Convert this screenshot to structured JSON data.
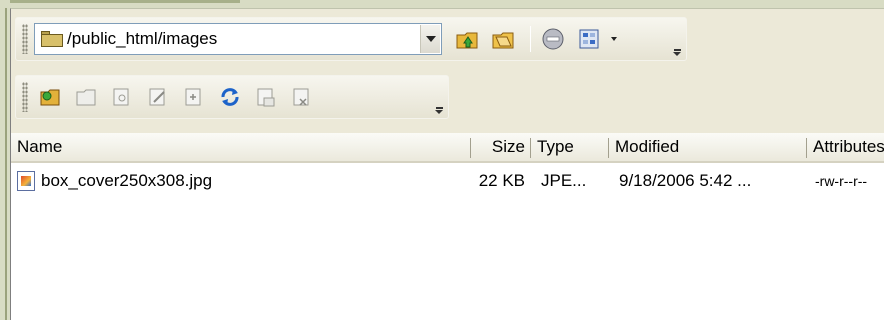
{
  "path_bar": {
    "path": "/public_html/images"
  },
  "toolbar1_icons": [
    "folder-up-icon",
    "folder-refresh-icon",
    "stop-icon",
    "view-mode-icon"
  ],
  "toolbar2_icons": [
    "new-folder-icon",
    "open-icon",
    "view-icon",
    "edit-icon",
    "new-file-icon",
    "refresh-icon",
    "properties-icon",
    "delete-icon"
  ],
  "columns": {
    "name": "Name",
    "size": "Size",
    "type": "Type",
    "modified": "Modified",
    "attributes": "Attributes"
  },
  "files": [
    {
      "name": "box_cover250x308.jpg",
      "size": "22 KB",
      "type": "JPE...",
      "modified": "9/18/2006 5:42 ...",
      "attributes": "-rw-r--r--"
    }
  ]
}
